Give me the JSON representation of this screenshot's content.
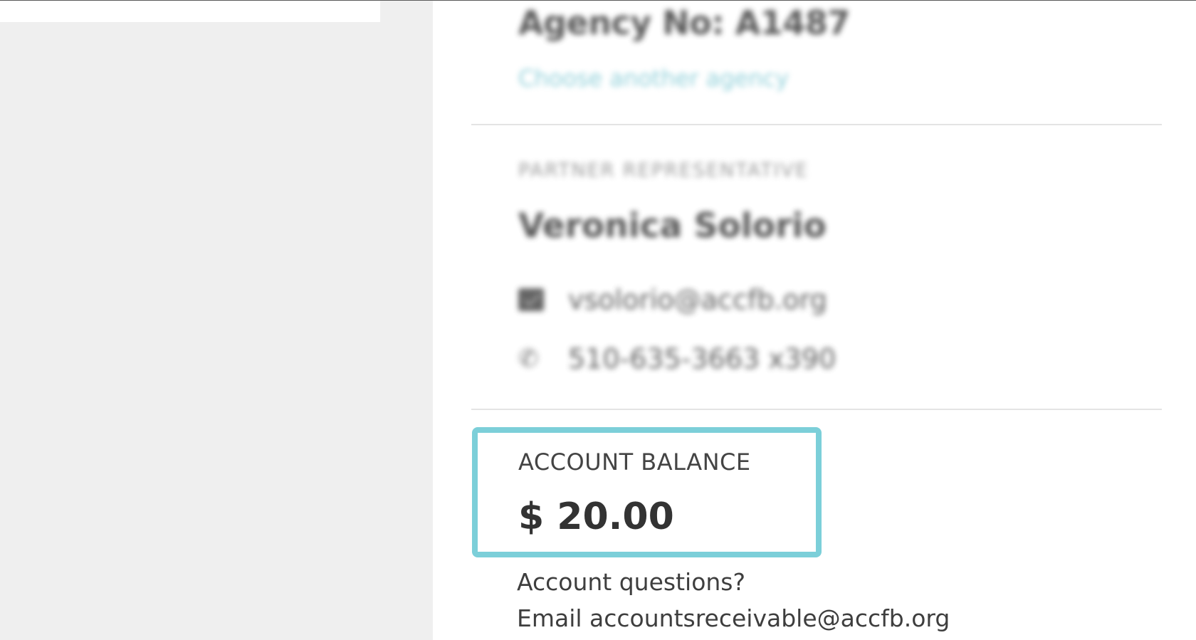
{
  "agency": {
    "number_label": "Agency No: A1487",
    "choose_link": "Choose another agency"
  },
  "partner_rep": {
    "section_label": "PARTNER REPRESENTATIVE",
    "name": "Veronica Solorio",
    "email": "vsolorio@accfb.org",
    "phone": "510-635-3663 x390",
    "email_icon": "envelope-icon",
    "phone_icon": "phone-icon"
  },
  "account": {
    "balance_label": "ACCOUNT BALANCE",
    "balance_value": "$ 20.00",
    "questions_label": "Account questions?",
    "contact_line": "Email accountsreceivable@accfb.org"
  },
  "colors": {
    "highlight_border": "#7ccfd9",
    "link": "#7ec8d3",
    "left_background": "#efefef"
  }
}
